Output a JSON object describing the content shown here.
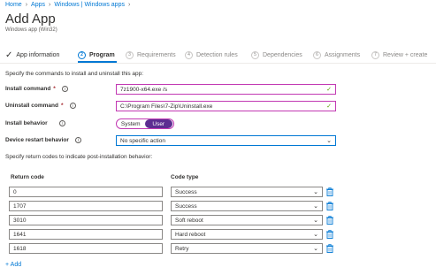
{
  "breadcrumb": {
    "items": [
      "Home",
      "Apps",
      "Windows | Windows apps"
    ]
  },
  "header": {
    "title": "Add App",
    "subtitle": "Windows app (Win32)"
  },
  "steps": [
    {
      "label": "App information",
      "state": "done",
      "num": ""
    },
    {
      "label": "Program",
      "state": "active",
      "num": "2"
    },
    {
      "label": "Requirements",
      "state": "pending",
      "num": "3"
    },
    {
      "label": "Detection rules",
      "state": "pending",
      "num": "4"
    },
    {
      "label": "Dependencies",
      "state": "pending",
      "num": "5"
    },
    {
      "label": "Assignments",
      "state": "pending",
      "num": "6"
    },
    {
      "label": "Review + create",
      "state": "pending",
      "num": "7"
    }
  ],
  "form": {
    "instruction": "Specify the commands to install and uninstall this app:",
    "install_command": {
      "label": "Install command",
      "value": "7z1900-x64.exe /s"
    },
    "uninstall_command": {
      "label": "Uninstall command",
      "value": "C:\\Program Files\\7-Zip\\Uninstall.exe"
    },
    "install_behavior": {
      "label": "Install behavior",
      "options": [
        "System",
        "User"
      ],
      "selected": "User"
    },
    "device_restart": {
      "label": "Device restart behavior",
      "value": "No specific action"
    },
    "return_instruction": "Specify return codes to indicate post-installation behavior:"
  },
  "return_codes": {
    "col_code": "Return code",
    "col_type": "Code type",
    "rows": [
      {
        "code": "0",
        "type": "Success"
      },
      {
        "code": "1707",
        "type": "Success"
      },
      {
        "code": "3010",
        "type": "Soft reboot"
      },
      {
        "code": "1641",
        "type": "Hard reboot"
      },
      {
        "code": "1618",
        "type": "Retry"
      }
    ],
    "add_label": "+ Add"
  },
  "colors": {
    "accent": "#0078d4",
    "active_border": "#c239b3",
    "toggle_selected": "#5c2d91",
    "valid": "#57a300"
  }
}
